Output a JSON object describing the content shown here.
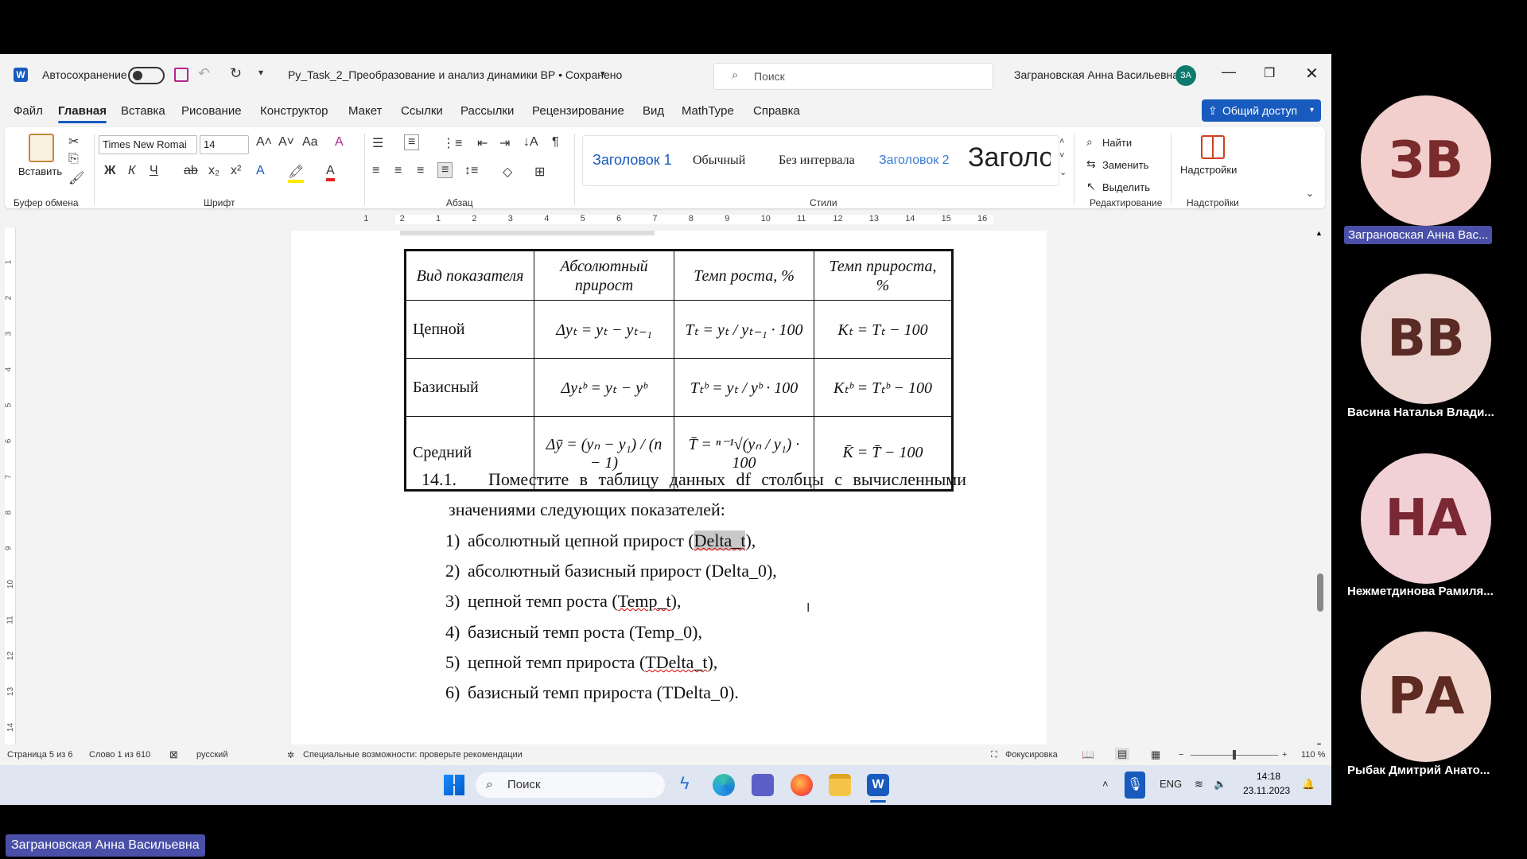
{
  "titlebar": {
    "autosave_label": "Автосохранение",
    "doc_title": "Py_Task_2_Преобразование и анализ динамики ВР • Сохранено",
    "search_placeholder": "Поиск",
    "user_name": "Заграновская Анна Васильевна",
    "user_initials": "ЗА"
  },
  "tabs": [
    "Файл",
    "Главная",
    "Вставка",
    "Рисование",
    "Конструктор",
    "Макет",
    "Ссылки",
    "Рассылки",
    "Рецензирование",
    "Вид",
    "MathType",
    "Справка"
  ],
  "share_label": "Общий доступ",
  "ribbon": {
    "paste_label": "Вставить",
    "font_name": "Times New Romai",
    "font_size": "14",
    "styles": [
      "Заголовок 1",
      "Обычный",
      "Без интервала",
      "Заголовок 2",
      "Заголо"
    ],
    "find_label": "Найти",
    "replace_label": "Заменить",
    "select_label": "Выделить",
    "addins_label": "Надстройки",
    "groups": {
      "clipboard": "Буфер обмена",
      "font": "Шрифт",
      "paragraph": "Абзац",
      "styles": "Стили",
      "editing": "Редактирование",
      "addins": "Надстройки"
    }
  },
  "ruler_numbers": [
    "1",
    "2",
    "1",
    "2",
    "3",
    "4",
    "5",
    "6",
    "7",
    "8",
    "9",
    "10",
    "11",
    "12",
    "13",
    "14",
    "15",
    "16"
  ],
  "vruler_numbers": [
    "1",
    "2",
    "3",
    "4",
    "5",
    "6",
    "7",
    "8",
    "9",
    "10",
    "11",
    "12",
    "13",
    "14"
  ],
  "doc_table": {
    "headers": [
      "Вид показателя",
      "Абсолютный прирост",
      "Темп роста, %",
      "Темп прироста, %"
    ],
    "rows": [
      {
        "label": "Цепной",
        "abs": "Δyₜ = yₜ − yₜ₋₁",
        "rate": "Tₜ = yₜ / yₜ₋₁ · 100",
        "growth": "Kₜ = Tₜ − 100"
      },
      {
        "label": "Базисный",
        "abs": "Δyₜᵇ = yₜ − yᵇ",
        "rate": "Tₜᵇ = yₜ / yᵇ · 100",
        "growth": "Kₜᵇ = Tₜᵇ − 100"
      },
      {
        "label": "Средний",
        "abs": "Δȳ = (yₙ − y₁) / (n − 1)",
        "rate": "T̄ = ⁿ⁻¹√(yₙ / y₁) · 100",
        "growth": "K̄ = T̄ − 100"
      }
    ]
  },
  "doc_text": {
    "section_num": "14.1.",
    "section_line1": "Поместите в таблицу данных df столбцы с вычисленными",
    "section_line2": "значениями следующих показателей:",
    "items": [
      {
        "num": "1)",
        "pre": "абсолютный цепной прирост (",
        "code": "Delta_t",
        "post": "),"
      },
      {
        "num": "2)",
        "pre": "абсолютный базисный прирост (",
        "code": "Delta_0",
        "post": "),"
      },
      {
        "num": "3)",
        "pre": "цепной темп роста (",
        "code": "Temp_t",
        "post": "),"
      },
      {
        "num": "4)",
        "pre": "базисный темп роста (",
        "code": "Temp_0",
        "post": "),"
      },
      {
        "num": "5)",
        "pre": "цепной темп прироста (",
        "code": "TDelta_t",
        "post": "),"
      },
      {
        "num": "6)",
        "pre": "базисный темп прироста (",
        "code": "TDelta_0",
        "post": ")."
      }
    ]
  },
  "statusbar": {
    "page": "Страница 5 из 6",
    "words": "Слово 1 из 610",
    "language": "русский",
    "accessibility": "Специальные возможности: проверьте рекомендации",
    "focus": "Фокусировка",
    "zoom": "110 %"
  },
  "taskbar": {
    "search_placeholder": "Поиск",
    "lang": "ENG",
    "time": "14:18",
    "date": "23.11.2023"
  },
  "participants": [
    {
      "initials": "ЗВ",
      "name": "Заграновская Анна Вас...",
      "color": "#f2cfcc",
      "text_color": "#7a2b2b",
      "active": true
    },
    {
      "initials": "ВВ",
      "name": "Васина Наталья Влади...",
      "color": "#ecd6d2",
      "text_color": "#5a2a24",
      "active": false
    },
    {
      "initials": "НА",
      "name": "Нежметдинова Рамиля...",
      "color": "#f1d1d6",
      "text_color": "#7a2833",
      "active": false
    },
    {
      "initials": "РА",
      "name": "Рыбак Дмитрий Анато...",
      "color": "#f0d6cf",
      "text_color": "#5e2a22",
      "active": false
    }
  ],
  "speaker_label": "Заграновская Анна Васильевна",
  "colors": {
    "accent": "#185abd",
    "teams_purple": "#4a4fa8"
  }
}
